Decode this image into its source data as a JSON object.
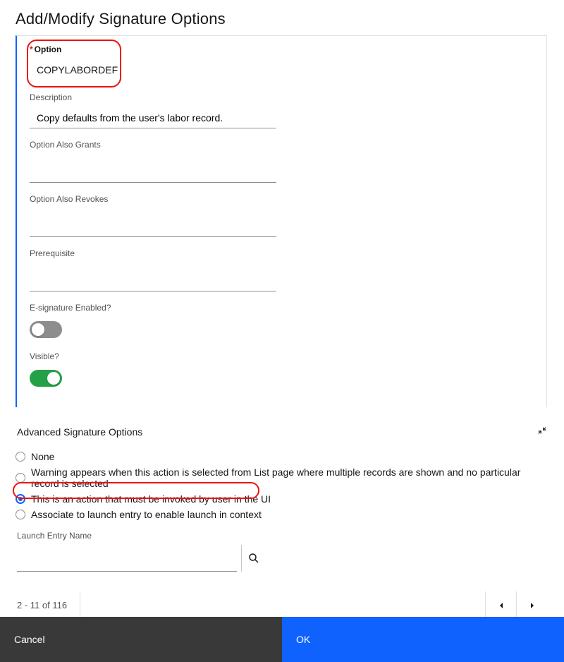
{
  "dialog": {
    "title": "Add/Modify Signature Options"
  },
  "form": {
    "option_label": "Option",
    "option_value": "COPYLABORDEF",
    "description_label": "Description",
    "description_value": "Copy defaults from the user's labor record.",
    "grants_label": "Option Also Grants",
    "grants_value": "",
    "revokes_label": "Option Also Revokes",
    "revokes_value": "",
    "prereq_label": "Prerequisite",
    "prereq_value": "",
    "esig_label": "E-signature Enabled?",
    "esig_on": false,
    "visible_label": "Visible?",
    "visible_on": true
  },
  "advanced": {
    "title": "Advanced Signature Options",
    "options": [
      "None",
      "Warning appears when this action is selected from List page where multiple records are shown and no particular record is selected",
      "This is an action that must be invoked by user in the UI",
      "Associate to launch entry to enable launch in context"
    ],
    "selected_index": 2,
    "launch_label": "Launch Entry Name",
    "launch_value": ""
  },
  "pager": {
    "info": "2 - 11 of 116"
  },
  "footer": {
    "cancel": "Cancel",
    "ok": "OK"
  }
}
